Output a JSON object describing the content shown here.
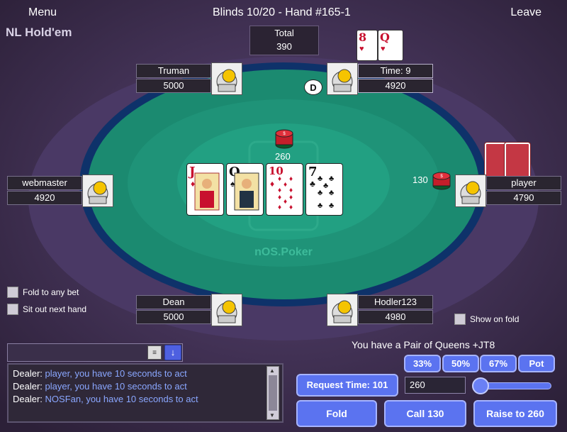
{
  "header": {
    "menu_label": "Menu",
    "blinds_label": "Blinds 10/20 - Hand #165-1",
    "leave_label": "Leave",
    "game_type": "NL Hold'em"
  },
  "pot": {
    "total_label": "Total",
    "total_value": "390"
  },
  "table": {
    "brand": "nOS.Poker",
    "felt_color": "#1c8a72",
    "rail_color": "#103a7a",
    "center_bet": "260",
    "dealer_label": "D"
  },
  "seats": {
    "truman": {
      "name": "Truman",
      "stack": "5000"
    },
    "timer": {
      "name": "Time: 9",
      "stack": "4920"
    },
    "webmaster": {
      "name": "webmaster",
      "stack": "4920"
    },
    "player": {
      "name": "player",
      "stack": "4790",
      "bet": "130"
    },
    "dean": {
      "name": "Dean",
      "stack": "5000"
    },
    "hodler": {
      "name": "Hodler123",
      "stack": "4980"
    }
  },
  "board_cards": [
    {
      "rank": "J",
      "suit": "♦",
      "color": "red"
    },
    {
      "rank": "Q",
      "suit": "♠",
      "color": "black"
    },
    {
      "rank": "10",
      "suit": "♦",
      "color": "red"
    },
    {
      "rank": "7",
      "suit": "♣",
      "color": "black"
    }
  ],
  "hole_cards_opponent": [
    {
      "rank": "8",
      "suit": "♥",
      "color": "red"
    },
    {
      "rank": "Q",
      "suit": "♥",
      "color": "red"
    }
  ],
  "options": {
    "fold_any": "Fold to any bet",
    "sit_out": "Sit out next hand",
    "show_on_fold": "Show on fold"
  },
  "hand_info": "You have a Pair of Queens +JT8",
  "chat": {
    "send_icon": "↓",
    "lines": [
      {
        "who": "Dealer:",
        "msg": " player, you have 10 seconds to act"
      },
      {
        "who": "Dealer:",
        "msg": " player, you have 10 seconds to act"
      },
      {
        "who": "Dealer:",
        "msg": " NOSFan, you have 10 seconds to act"
      }
    ]
  },
  "actions": {
    "pct33": "33%",
    "pct50": "50%",
    "pct67": "67%",
    "pot": "Pot",
    "request_time": "Request Time: 101",
    "bet_value": "260",
    "fold": "Fold",
    "call": "Call 130",
    "raise": "Raise to 260",
    "slider_fraction": 0
  }
}
